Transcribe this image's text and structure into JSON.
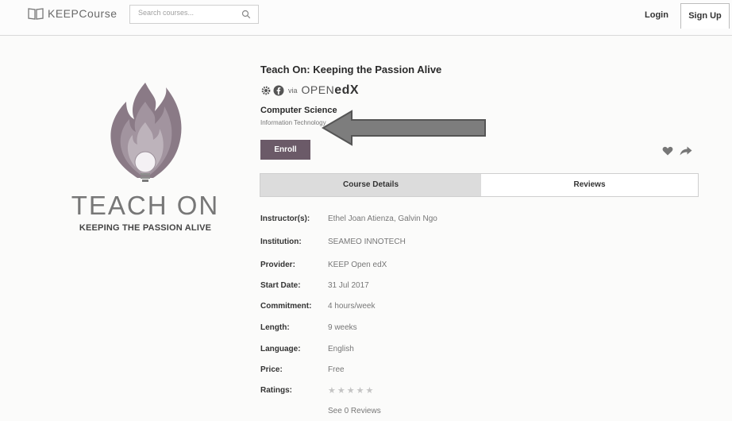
{
  "header": {
    "logo_text": "KEEPCourse",
    "search_placeholder": "Search courses...",
    "login_label": "Login",
    "signup_label": "Sign Up"
  },
  "hero": {
    "title": "TEACH ON",
    "tagline": "KEEPING THE PASSION ALIVE"
  },
  "course": {
    "title": "Teach On: Keeping the Passion Alive",
    "via": "via",
    "platform_prefix": "OPEN",
    "platform_suffix": "edX",
    "subject": "Computer Science",
    "subsubject": "Information Technology",
    "enroll_label": "Enroll"
  },
  "tabs": {
    "details": "Course Details",
    "reviews": "Reviews"
  },
  "details": {
    "instructor_label": "Instructor(s):",
    "instructor_value": "Ethel Joan Atienza, Galvin Ngo",
    "institution_label": "Institution:",
    "institution_value": "SEAMEO INNOTECH",
    "provider_label": "Provider:",
    "provider_value": "KEEP Open edX",
    "start_label": "Start Date:",
    "start_value": "31 Jul 2017",
    "commitment_label": "Commitment:",
    "commitment_value": "4 hours/week",
    "length_label": "Length:",
    "length_value": "9 weeks",
    "language_label": "Language:",
    "language_value": "English",
    "price_label": "Price:",
    "price_value": "Free",
    "ratings_label": "Ratings:",
    "ratings_stars": "★★★★★",
    "ratings_value": 0,
    "see_reviews": "See 0 Reviews"
  },
  "colors": {
    "enroll_bg": "#6b5a68",
    "tab_active_bg": "#dcdcdc",
    "flame_outer": "#8a7a86",
    "flame_inner": "#bdb3bb"
  }
}
